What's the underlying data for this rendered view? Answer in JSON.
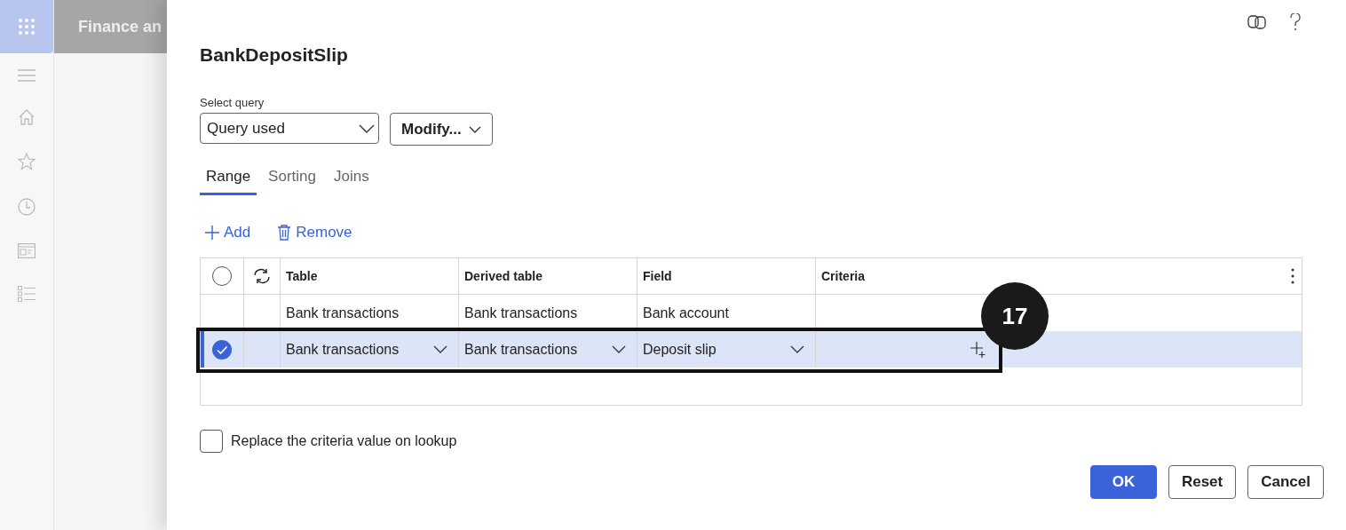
{
  "app_bar": {
    "title": "Finance an"
  },
  "dialog": {
    "title": "BankDepositSlip",
    "select_query": {
      "label": "Select query",
      "value": "Query used"
    },
    "modify_button": "Modify...",
    "tabs": [
      {
        "label": "Range",
        "selected": true
      },
      {
        "label": "Sorting",
        "selected": false
      },
      {
        "label": "Joins",
        "selected": false
      }
    ],
    "toolbar": [
      {
        "label": "Add",
        "kind": "add"
      },
      {
        "label": "Remove",
        "kind": "remove"
      }
    ],
    "grid": {
      "select_all_checked": false,
      "columns": [
        "Table",
        "Derived table",
        "Field",
        "Criteria"
      ],
      "rows": [
        {
          "selected": false,
          "table": "Bank transactions",
          "derived_table": "Bank transactions",
          "field": "Bank account"
        },
        {
          "selected": true,
          "table": "Bank transactions",
          "derived_table": "Bank transactions",
          "field": "Deposit slip"
        }
      ]
    },
    "callout": {
      "number": "17"
    },
    "replace_checkbox": {
      "label": "Replace the criteria value on lookup",
      "checked": false
    },
    "buttons": [
      {
        "label": "OK",
        "kind": "primary"
      },
      {
        "label": "Reset",
        "kind": "secondary"
      },
      {
        "label": "Cancel",
        "kind": "secondary"
      }
    ]
  }
}
